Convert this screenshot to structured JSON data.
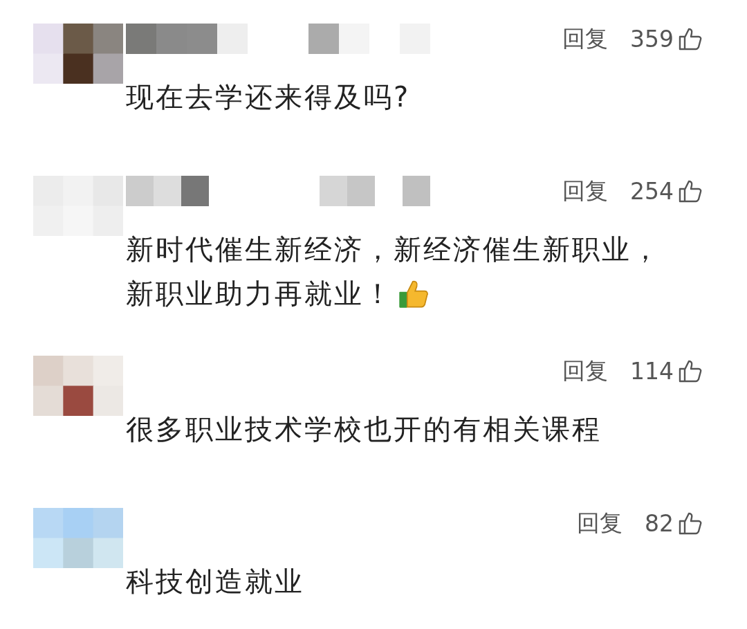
{
  "comments": [
    {
      "reply": "回复",
      "likes": "359",
      "lines": [
        "现在去学还来得及吗?"
      ],
      "emoji": false
    },
    {
      "reply": "回复",
      "likes": "254",
      "lines": [
        "新时代催生新经济，新经济催生新职业，",
        "新职业助力再就业！"
      ],
      "emoji": true
    },
    {
      "reply": "回复",
      "likes": "114",
      "lines": [
        "很多职业技术学校也开的有相关课程"
      ],
      "emoji": false
    },
    {
      "reply": "回复",
      "likes": "82",
      "lines": [
        "科技创造就业"
      ],
      "emoji": false
    }
  ]
}
